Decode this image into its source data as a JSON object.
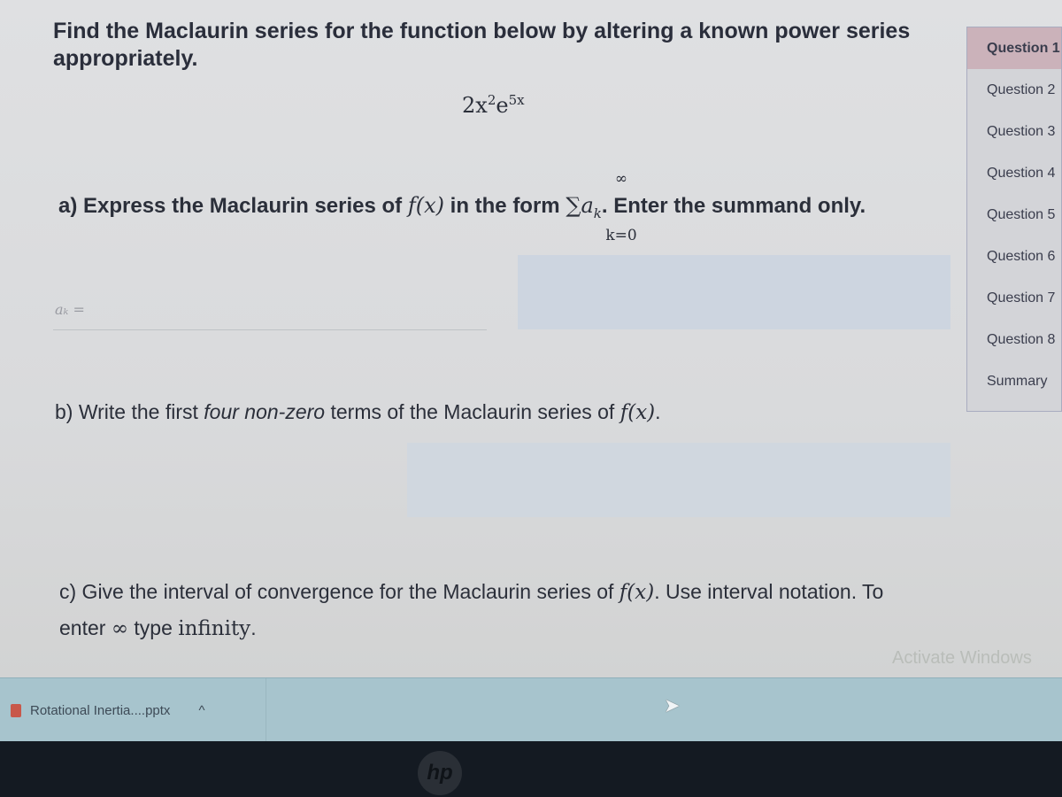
{
  "question": {
    "title": "Find the Maclaurin series for the function below by altering a known power series appropriately.",
    "function_base": "2x",
    "function_exp1": "2",
    "function_e": "e",
    "function_exp2": "5x",
    "part_a": {
      "prefix": "a) Express the Maclaurin series of ",
      "fx": "f(x)",
      "mid": " in the form ",
      "sigma": "∑",
      "term": "a",
      "sub": "k",
      "upper": "∞",
      "lower": "k=0",
      "suffix": ". Enter the summand only.",
      "input_label": "aₖ =",
      "input_value": ""
    },
    "part_b": {
      "prefix": "b) Write the first ",
      "emphasis": "four non-zero",
      "mid": " terms of the Maclaurin series of ",
      "fx": "f(x)",
      "suffix": ".",
      "input_value": ""
    },
    "part_c": {
      "prefix": "c) Give the interval of convergence for the Maclaurin series of ",
      "fx": "f(x)",
      "mid": ". Use interval notation. To enter ",
      "infinity": "∞",
      "type_text": " type ",
      "code": "infinity",
      "suffix": "."
    }
  },
  "sidebar": {
    "items": [
      {
        "label": "Question 1",
        "active": true
      },
      {
        "label": "Question 2"
      },
      {
        "label": "Question 3"
      },
      {
        "label": "Question 4"
      },
      {
        "label": "Question 5"
      },
      {
        "label": "Question 6"
      },
      {
        "label": "Question 7"
      },
      {
        "label": "Question 8"
      },
      {
        "label": "Summary"
      }
    ]
  },
  "watermark": "Activate Windows",
  "download_bar": {
    "file_name": "Rotational Inertia....pptx",
    "chevron": "^",
    "file_icon": "powerpoint-icon"
  },
  "bezel_logo": "hp",
  "colors": {
    "active_item": "#cbb2ba",
    "download_bar": "#a7c4cd"
  }
}
